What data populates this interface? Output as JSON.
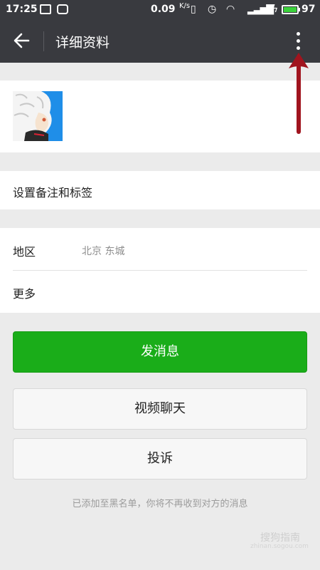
{
  "status_bar": {
    "time": "17:25",
    "net_speed": "0.09",
    "net_speed_unit": "K/s",
    "battery_level": "97",
    "battery_color": "#3cd23c"
  },
  "header": {
    "title": "详细资料",
    "back_icon": "arrow-left-icon",
    "menu_icon": "more-vertical-icon",
    "background": "#393a3f"
  },
  "profile": {
    "avatar_icon": "avatar-illustration"
  },
  "remark": {
    "label": "设置备注和标签"
  },
  "info_rows": [
    {
      "label": "地区",
      "value": "北京  东城"
    },
    {
      "label": "更多",
      "value": ""
    }
  ],
  "actions": {
    "send_message": "发消息",
    "video_chat": "视频聊天",
    "report": "投诉",
    "primary_color": "#1aad19"
  },
  "blacklist_notice": "已添加至黑名单，你将不再收到对方的消息",
  "watermark": {
    "text": "搜狗指南",
    "url": "zhinan.sogou.com"
  },
  "annotation": {
    "arrow_color": "#a0141e"
  }
}
